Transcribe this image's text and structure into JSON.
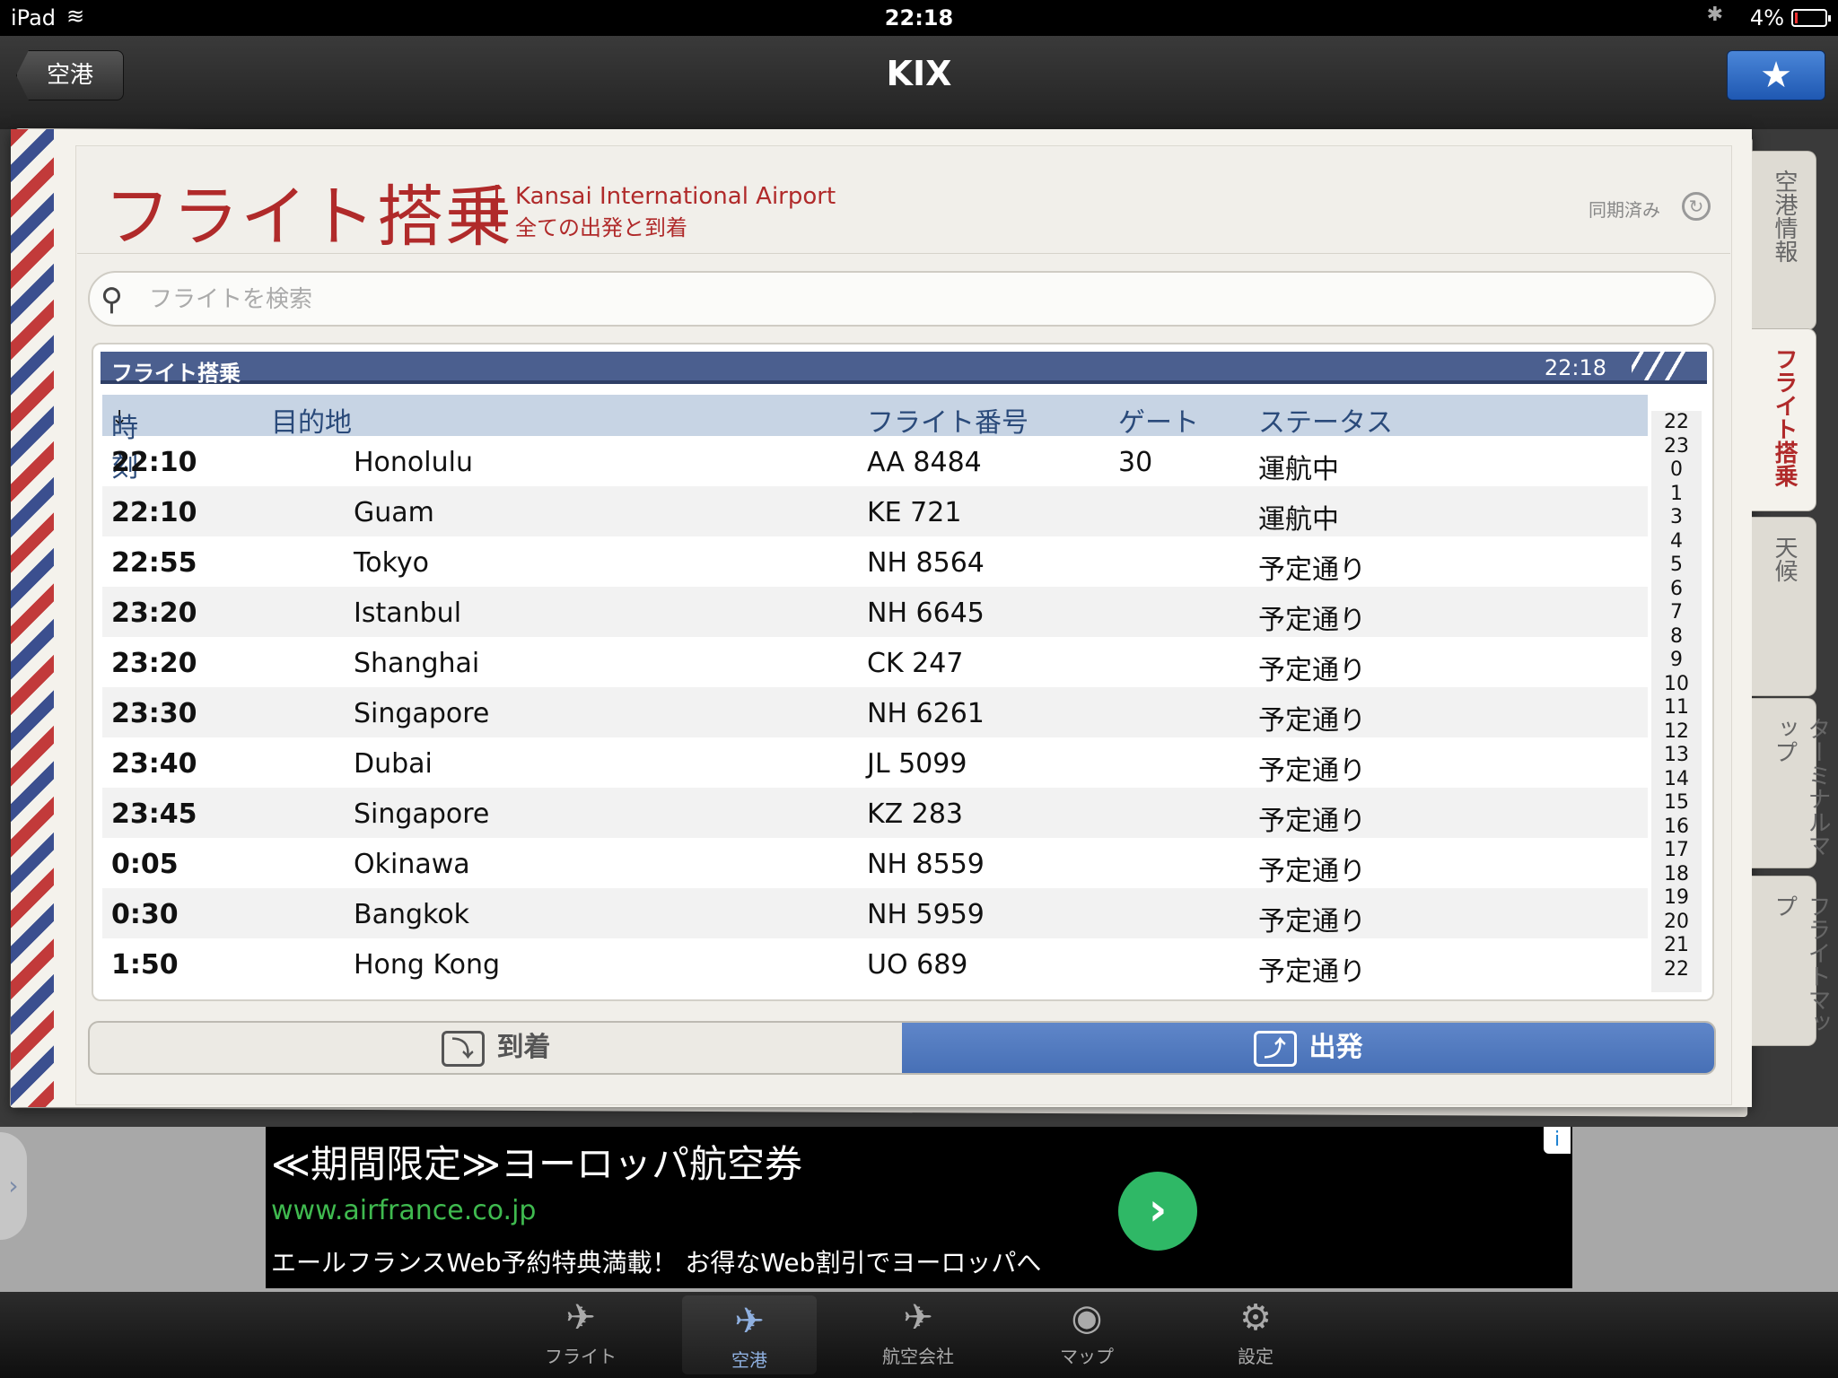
{
  "status_bar": {
    "device": "iPad",
    "time": "22:18",
    "battery": "4%"
  },
  "nav": {
    "back_label": "空港",
    "title": "KIX",
    "fav_icon": "★"
  },
  "header": {
    "title": "フライト搭乗",
    "airport": "Kansai International Airport",
    "subtitle": "全ての出発と到着",
    "sync_label": "同期済み"
  },
  "search": {
    "placeholder": "フライトを検索"
  },
  "board": {
    "title": "フライト搭乗",
    "time": "22:18",
    "columns": {
      "time": "時刻",
      "destination": "目的地",
      "flight": "フライト番号",
      "gate": "ゲート",
      "status": "ステータス"
    },
    "rows": [
      {
        "time": "22:10",
        "destination": "Honolulu",
        "flight": "AA 8484",
        "gate": "30",
        "status": "運航中"
      },
      {
        "time": "22:10",
        "destination": "Guam",
        "flight": "KE 721",
        "gate": "",
        "status": "運航中"
      },
      {
        "time": "22:55",
        "destination": "Tokyo",
        "flight": "NH 8564",
        "gate": "",
        "status": "予定通り"
      },
      {
        "time": "23:20",
        "destination": "Istanbul",
        "flight": "NH 6645",
        "gate": "",
        "status": "予定通り"
      },
      {
        "time": "23:20",
        "destination": "Shanghai",
        "flight": "CK 247",
        "gate": "",
        "status": "予定通り"
      },
      {
        "time": "23:30",
        "destination": "Singapore",
        "flight": "NH 6261",
        "gate": "",
        "status": "予定通り"
      },
      {
        "time": "23:40",
        "destination": "Dubai",
        "flight": "JL 5099",
        "gate": "",
        "status": "予定通り"
      },
      {
        "time": "23:45",
        "destination": "Singapore",
        "flight": "KZ 283",
        "gate": "",
        "status": "予定通り"
      },
      {
        "time": "0:05",
        "destination": "Okinawa",
        "flight": "NH 8559",
        "gate": "",
        "status": "予定通り"
      },
      {
        "time": "0:30",
        "destination": "Bangkok",
        "flight": "NH 5959",
        "gate": "",
        "status": "予定通り"
      },
      {
        "time": "1:50",
        "destination": "Hong Kong",
        "flight": "UO 689",
        "gate": "",
        "status": "予定通り"
      }
    ],
    "hour_index": [
      "22",
      "23",
      "0",
      "1",
      "3",
      "4",
      "5",
      "6",
      "7",
      "8",
      "9",
      "10",
      "11",
      "12",
      "13",
      "14",
      "15",
      "16",
      "17",
      "18",
      "19",
      "20",
      "21",
      "22"
    ]
  },
  "segment": {
    "arrival": "到着",
    "departure": "出発",
    "selected": "departure"
  },
  "side_tabs": [
    "空港情報",
    "フライト搭乗",
    "天候",
    "ターミナルマップ",
    "フライトマップ"
  ],
  "ad": {
    "headline": "≪期間限定≫ヨーロッパ航空券",
    "url": "www.airfrance.co.jp",
    "description": "エールフランスWeb予約特典満載！ お得なWeb割引でヨーロッパへ"
  },
  "tab_bar": [
    {
      "label": "フライト",
      "icon": "airplane-icon"
    },
    {
      "label": "空港",
      "icon": "airport-icon"
    },
    {
      "label": "航空会社",
      "icon": "airline-icon"
    },
    {
      "label": "マップ",
      "icon": "map-icon"
    },
    {
      "label": "設定",
      "icon": "gear-icon"
    }
  ]
}
